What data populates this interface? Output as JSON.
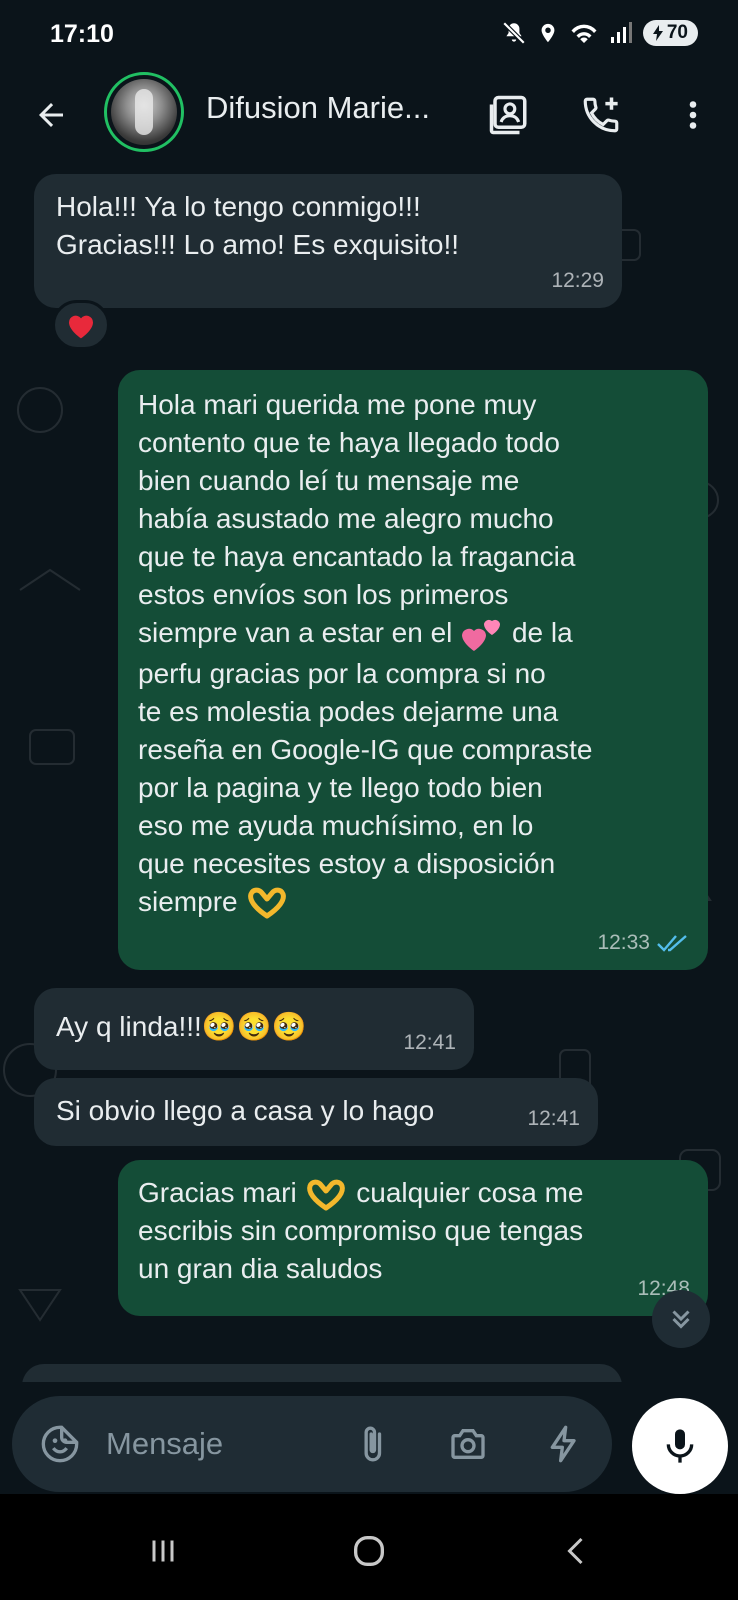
{
  "status_bar": {
    "time": "17:10",
    "battery": "70",
    "icons": [
      "mute-icon",
      "location-icon",
      "wifi-icon",
      "signal-icon",
      "battery-icon"
    ]
  },
  "header": {
    "title": "Difusion Marie...",
    "icons": [
      "back-arrow-icon",
      "contact-card-icon",
      "add-call-icon",
      "more-vert-icon"
    ],
    "accent": "#21c063"
  },
  "messages": [
    {
      "direction": "in",
      "text": "Hola!!! Ya lo tengo conmigo!!!\nGracias!!! Lo amo! Es exquisito!!",
      "time": "12:29",
      "reaction": "❤️"
    },
    {
      "direction": "out",
      "text_before_emoji": "Hola mari querida me pone muy\ncontento que te haya llegado todo\nbien cuando leí tu mensaje me\nhabía asustado me alegro mucho\nque te haya encantado la fragancia\nestos envíos son los primeros\nsiempre van a estar en el ",
      "emoji1": "💕",
      "text_after_emoji": " de la\nperfu gracias por la compra si no\nte es molestia podes dejarme una\nreseña en Google-IG que compraste\npor la pagina y te llego todo bien\neso me ayuda muchísimo, en lo\nque necesites estoy a disposición\nsiempre ",
      "emoji2": "🫶",
      "time": "12:33",
      "status": "read"
    },
    {
      "direction": "in",
      "text": "Ay q linda!!!🥹🥹🥹",
      "time": "12:41"
    },
    {
      "direction": "in",
      "text": "Si obvio llego a casa y lo hago",
      "time": "12:41"
    },
    {
      "direction": "out",
      "text_before_emoji": "Gracias mari ",
      "emoji1": "🫶",
      "text_after_emoji": " cualquier cosa me\nescribis sin compromiso que tengas\nun gran dia saludos",
      "time": "12:48"
    }
  ],
  "composer": {
    "placeholder": "Mensaje",
    "icons": [
      "sticker-icon",
      "attach-icon",
      "camera-icon",
      "bolt-icon",
      "mic-icon"
    ]
  },
  "navbar": {
    "icons": [
      "recents-icon",
      "home-icon",
      "back-icon"
    ]
  },
  "colors": {
    "background": "#0b141a",
    "incoming_bubble": "#202c33",
    "outgoing_bubble": "#144d37",
    "read_ticks": "#53bdeb"
  }
}
